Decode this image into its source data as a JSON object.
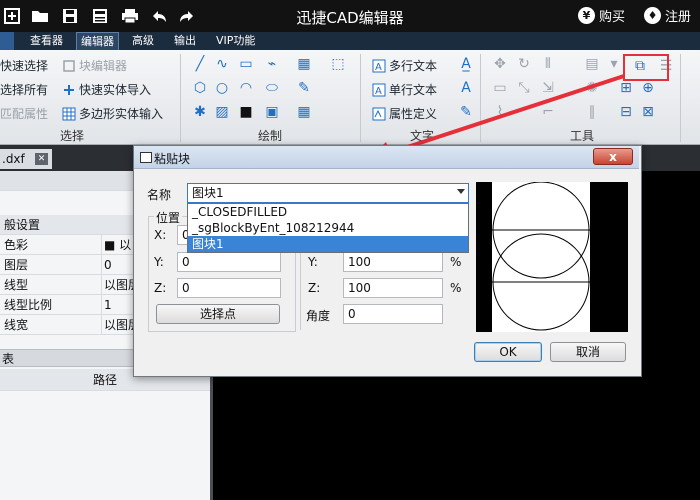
{
  "app": {
    "title": "迅捷CAD编辑器",
    "buy_label": "购买",
    "register_label": "注册",
    "buy_icon_glyph": "¥",
    "register_icon_glyph": "♦"
  },
  "menu": {
    "tabs": [
      "查看器",
      "编辑器",
      "高级",
      "输出",
      "VIP功能"
    ],
    "active": "编辑器"
  },
  "ribbon": {
    "select_group": {
      "items": [
        "快速选择",
        "选择所有",
        "匹配属性",
        "块编辑器",
        "快速实体导入",
        "多边形实体输入"
      ],
      "label": "选择"
    },
    "draw_group": {
      "label": "绘制"
    },
    "text_group": {
      "items": [
        "多行文本",
        "单行文本",
        "属性定义"
      ],
      "label": "文字"
    },
    "tools_group": {
      "label": "工具"
    }
  },
  "document": {
    "tab_name": ".dxf"
  },
  "properties": {
    "header": "般设置",
    "rows": [
      {
        "key": "色彩",
        "value": "■ 以"
      },
      {
        "key": "图层",
        "value": "0"
      },
      {
        "key": "线型",
        "value": "以图层"
      },
      {
        "key": "线型比例",
        "value": "1"
      },
      {
        "key": "线宽",
        "value": "以图层"
      }
    ],
    "lower_header_left": "表",
    "lower_header_col": "路径"
  },
  "dialog": {
    "title": "粘贴块",
    "name_label": "名称",
    "selected_name": "图块1",
    "options": [
      "_CLOSEDFILLED",
      "_sgBlockByEnt_108212944",
      "图块1"
    ],
    "position": {
      "label": "位置",
      "x_label": "X:",
      "x_value": "0",
      "y_label": "Y:",
      "y_value": "0",
      "z_label": "Z:",
      "z_value": "0",
      "pick_button": "选择点"
    },
    "scale": {
      "y_label": "Y:",
      "y_value": "100",
      "z_label": "Z:",
      "z_value": "100",
      "unit": "%"
    },
    "angle": {
      "label": "角度",
      "value": "0"
    },
    "ok_button": "OK",
    "cancel_button": "取消",
    "close_glyph": "x"
  }
}
